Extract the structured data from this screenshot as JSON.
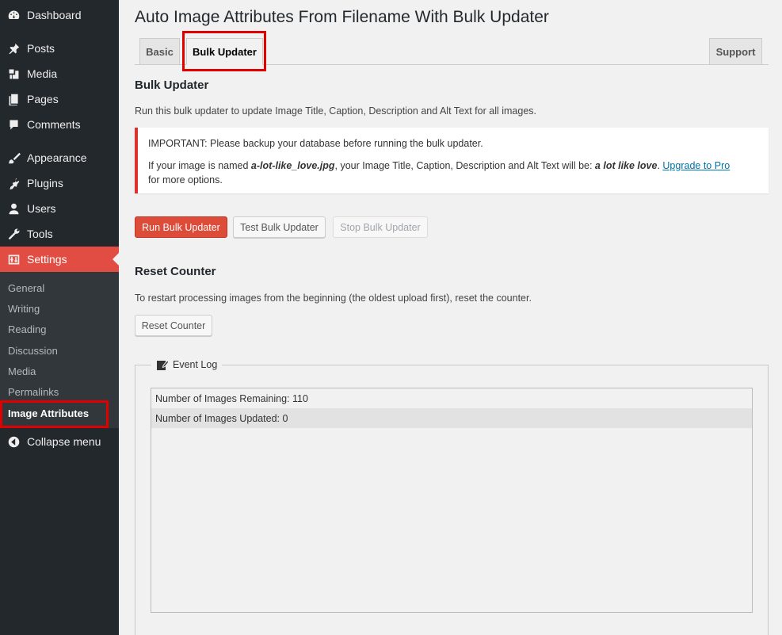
{
  "sidebar": {
    "menu": [
      {
        "label": "Dashboard",
        "icon": "dashboard-icon"
      },
      {
        "label": "Posts",
        "icon": "pin-icon"
      },
      {
        "label": "Media",
        "icon": "media-icon"
      },
      {
        "label": "Pages",
        "icon": "pages-icon"
      },
      {
        "label": "Comments",
        "icon": "comment-icon"
      },
      {
        "label": "Appearance",
        "icon": "brush-icon"
      },
      {
        "label": "Plugins",
        "icon": "plugin-icon"
      },
      {
        "label": "Users",
        "icon": "user-icon"
      },
      {
        "label": "Tools",
        "icon": "wrench-icon"
      },
      {
        "label": "Settings",
        "icon": "settings-icon"
      }
    ],
    "submenu": [
      "General",
      "Writing",
      "Reading",
      "Discussion",
      "Media",
      "Permalinks",
      "Image Attributes"
    ],
    "collapse_label": "Collapse menu",
    "active_color": "#e14d43"
  },
  "page": {
    "title": "Auto Image Attributes From Filename With Bulk Updater",
    "tabs": {
      "basic": "Basic",
      "bulk": "Bulk Updater",
      "support": "Support"
    }
  },
  "bulk": {
    "heading": "Bulk Updater",
    "description": "Run this bulk updater to update Image Title, Caption, Description and Alt Text for all images.",
    "notice": {
      "important": "IMPORTANT: Please backup your database before running the bulk updater.",
      "line2_prefix": "If your image is named ",
      "filename": "a-lot-like_love.jpg",
      "line2_mid": ", your Image Title, Caption, Description and Alt Text will be: ",
      "result": "a lot like love",
      "period": ".",
      "link": "Upgrade to Pro",
      "line3": "for more options."
    },
    "buttons": {
      "run": "Run Bulk Updater",
      "test": "Test Bulk Updater",
      "stop": "Stop Bulk Updater"
    }
  },
  "reset": {
    "heading": "Reset Counter",
    "description": "To restart processing images from the beginning (the oldest upload first), reset the counter.",
    "button": "Reset Counter"
  },
  "event_log": {
    "legend": "Event Log",
    "rows": [
      "Number of Images Remaining: 110",
      "Number of Images Updated: 0"
    ]
  }
}
